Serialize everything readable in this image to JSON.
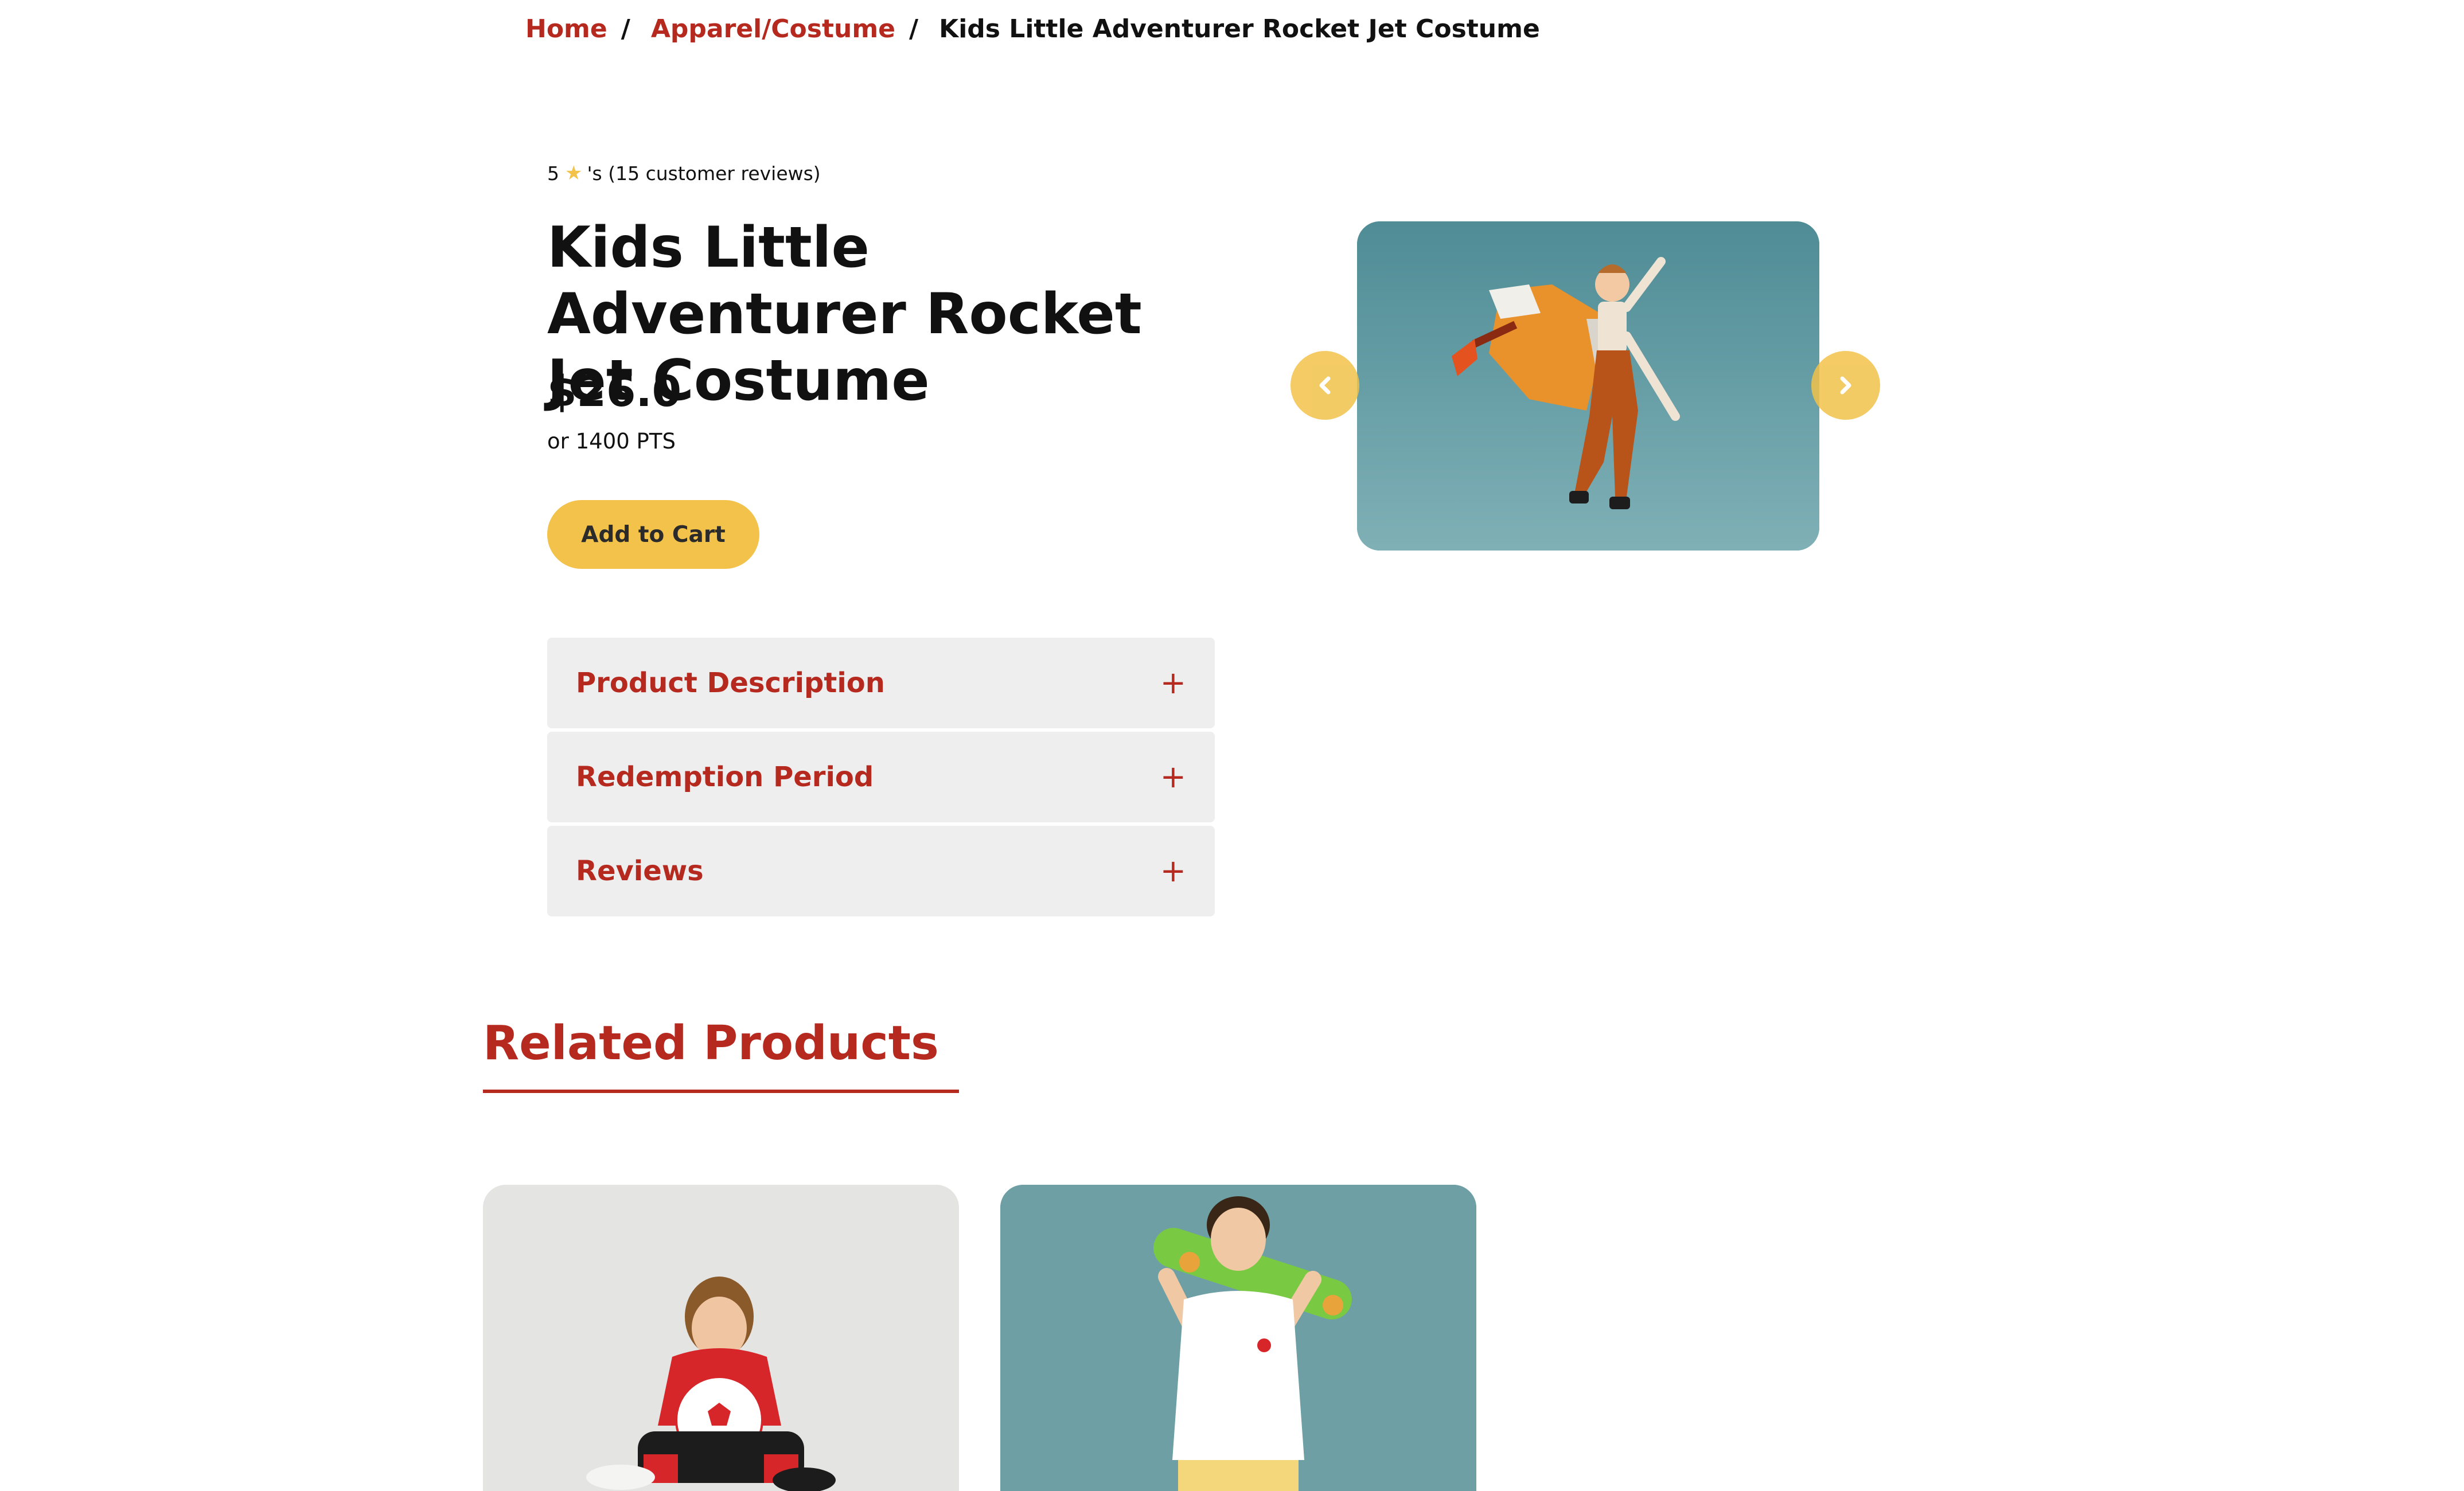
{
  "breadcrumb": {
    "home": "Home",
    "sep1": "/",
    "category": "Apparel/Costume",
    "sep2": "/",
    "current": "Kids Little Adventurer Rocket Jet Costume"
  },
  "product": {
    "rating_value": "5",
    "rating_suffix": "'s (15 customer reviews)",
    "title": "Kids Little Adventurer Rocket Jet Costume",
    "price": "$26.0",
    "points": "or 1400 PTS",
    "add_to_cart_label": "Add to Cart"
  },
  "accordion": {
    "items": [
      {
        "label": "Product Description",
        "icon": "+"
      },
      {
        "label": "Redemption Period",
        "icon": "+"
      },
      {
        "label": "Reviews",
        "icon": "+"
      }
    ]
  },
  "carousel": {
    "prev_icon": "chevron-left-icon",
    "next_icon": "chevron-right-icon"
  },
  "related": {
    "title": "Related Products"
  },
  "colors": {
    "accent_red": "#b5291f",
    "accent_yellow": "#f2c24a",
    "accordion_bg": "#eeeeee"
  }
}
